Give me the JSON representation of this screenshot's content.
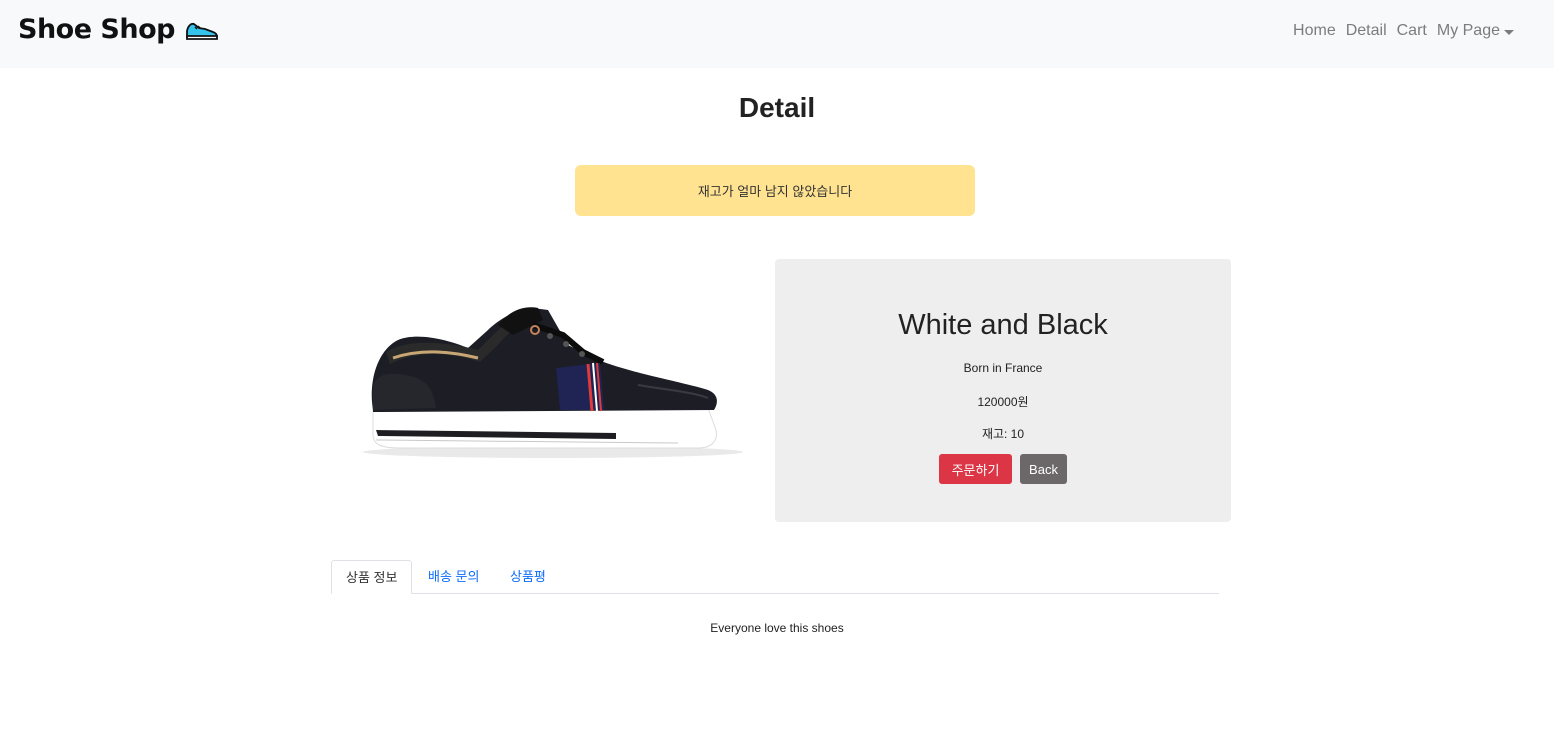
{
  "navbar": {
    "brand": "Shoe Shop",
    "links": {
      "home": "Home",
      "detail": "Detail",
      "cart": "Cart",
      "mypage": "My Page"
    }
  },
  "page_title": "Detail",
  "alert_text": "재고가 얼마 남지 않았습니다",
  "product": {
    "name": "White and Black",
    "origin": "Born in France",
    "price": "120000원",
    "stock": "재고: 10",
    "order_button": "주문하기",
    "back_button": "Back"
  },
  "tabs": [
    {
      "label": "상품 정보",
      "active": true
    },
    {
      "label": "배송 문의",
      "active": false
    },
    {
      "label": "상품평",
      "active": false
    }
  ],
  "tab_content": "Everyone love this shoes",
  "colors": {
    "alert_bg": "#ffe391",
    "order_button": "#dc3545",
    "back_button": "#6c6869",
    "tab_link": "#0d6efd"
  }
}
